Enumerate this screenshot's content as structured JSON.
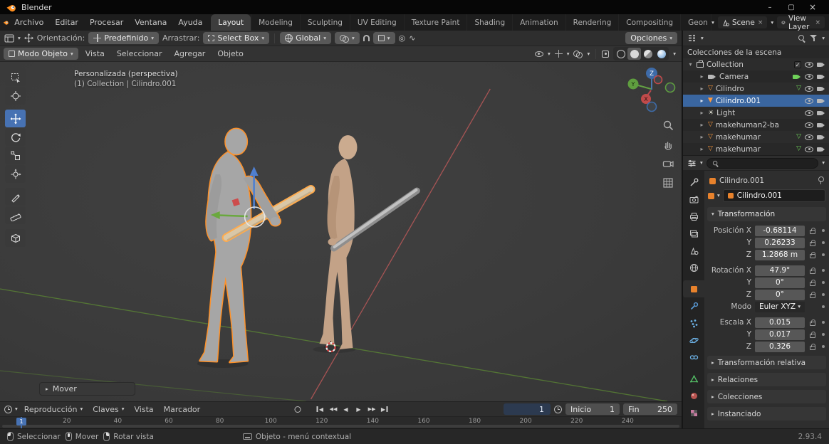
{
  "titlebar": {
    "app_name": "Blender"
  },
  "menubar": {
    "menus": [
      "Archivo",
      "Editar",
      "Procesar",
      "Ventana",
      "Ayuda"
    ],
    "workspaces": [
      "Layout",
      "Modeling",
      "Sculpting",
      "UV Editing",
      "Texture Paint",
      "Shading",
      "Animation",
      "Rendering",
      "Compositing",
      "Geon"
    ],
    "active_workspace": "Layout",
    "scene_selector": "Scene",
    "view_layer_selector": "View Layer"
  },
  "tool_header": {
    "orientation_label": "Orientación:",
    "orientation_value": "Predefinido",
    "drag_label": "Arrastrar:",
    "drag_value": "Select Box",
    "transform_space": "Global",
    "options_label": "Opciones"
  },
  "viewport_header": {
    "mode": "Modo Objeto",
    "menus": [
      "Vista",
      "Seleccionar",
      "Agregar",
      "Objeto"
    ]
  },
  "viewport": {
    "view_name": "Personalizada (perspectiva)",
    "breadcrumb": "(1) Collection | Cilindro.001",
    "operator_panel": "Mover",
    "gizmo_axis_x": "X",
    "gizmo_axis_y": "Y",
    "gizmo_axis_z": "Z"
  },
  "timeline": {
    "playback_menu": "Reproducción",
    "keys_menu": "Claves",
    "view_menu": "Vista",
    "marker_menu": "Marcador",
    "current_frame": "1",
    "playhead_frame": "1",
    "start_label": "Inicio",
    "start_value": "1",
    "end_label": "Fin",
    "end_value": "250",
    "ticks": [
      "20",
      "40",
      "60",
      "80",
      "100",
      "120",
      "140",
      "160",
      "180",
      "200",
      "220",
      "240"
    ]
  },
  "statusbar": {
    "left_click": "Seleccionar",
    "middle_click": "Mover",
    "right_click": "Rotar vista",
    "context": "Objeto - menú contextual",
    "version": "2.93.4"
  },
  "outliner": {
    "root": "Colecciones de la escena",
    "rows": [
      {
        "label": "Collection"
      },
      {
        "label": "Camera"
      },
      {
        "label": "Cilindro"
      },
      {
        "label": "Cilindro.001"
      },
      {
        "label": "Light"
      },
      {
        "label": "makehuman2-ba"
      },
      {
        "label": "makehumar"
      },
      {
        "label": "makehumar"
      }
    ]
  },
  "properties": {
    "breadcrumb_object": "Cilindro.001",
    "object_name": "Cilindro.001",
    "transform_title": "Transformación",
    "location": {
      "x_label": "Posición X",
      "x": "-0.68114",
      "y_label": "Y",
      "y": "0.26233",
      "z_label": "Z",
      "z": "1.2868 m"
    },
    "rotation": {
      "x_label": "Rotación X",
      "x": "47.9°",
      "y_label": "Y",
      "y": "0°",
      "z_label": "Z",
      "z": "0°"
    },
    "mode_label": "Modo",
    "mode_value": "Euler XYZ",
    "scale": {
      "x_label": "Escala X",
      "x": "0.015",
      "y_label": "Y",
      "y": "0.017",
      "z_label": "Z",
      "z": "0.326"
    },
    "collapsed_sections": [
      "Transformación relativa",
      "Relaciones",
      "Colecciones",
      "Instanciado"
    ]
  },
  "colors": {
    "accent_blue": "#4772b3",
    "selection_orange": "#ff9128",
    "object_orange": "#e8822c",
    "selected_row_blue": "#3a66a0"
  },
  "icons": {
    "chevron_down": "▾",
    "chevron_right": "▸",
    "check": "✓",
    "close": "×",
    "minimize": "–",
    "restore": "▢",
    "mesh_triangle": "▽",
    "mesh_triangle_filled": "▼",
    "light_sun": "☀",
    "play": "▶",
    "play_reverse": "◀",
    "proportional": "◎",
    "falloff_wave": "∿"
  }
}
